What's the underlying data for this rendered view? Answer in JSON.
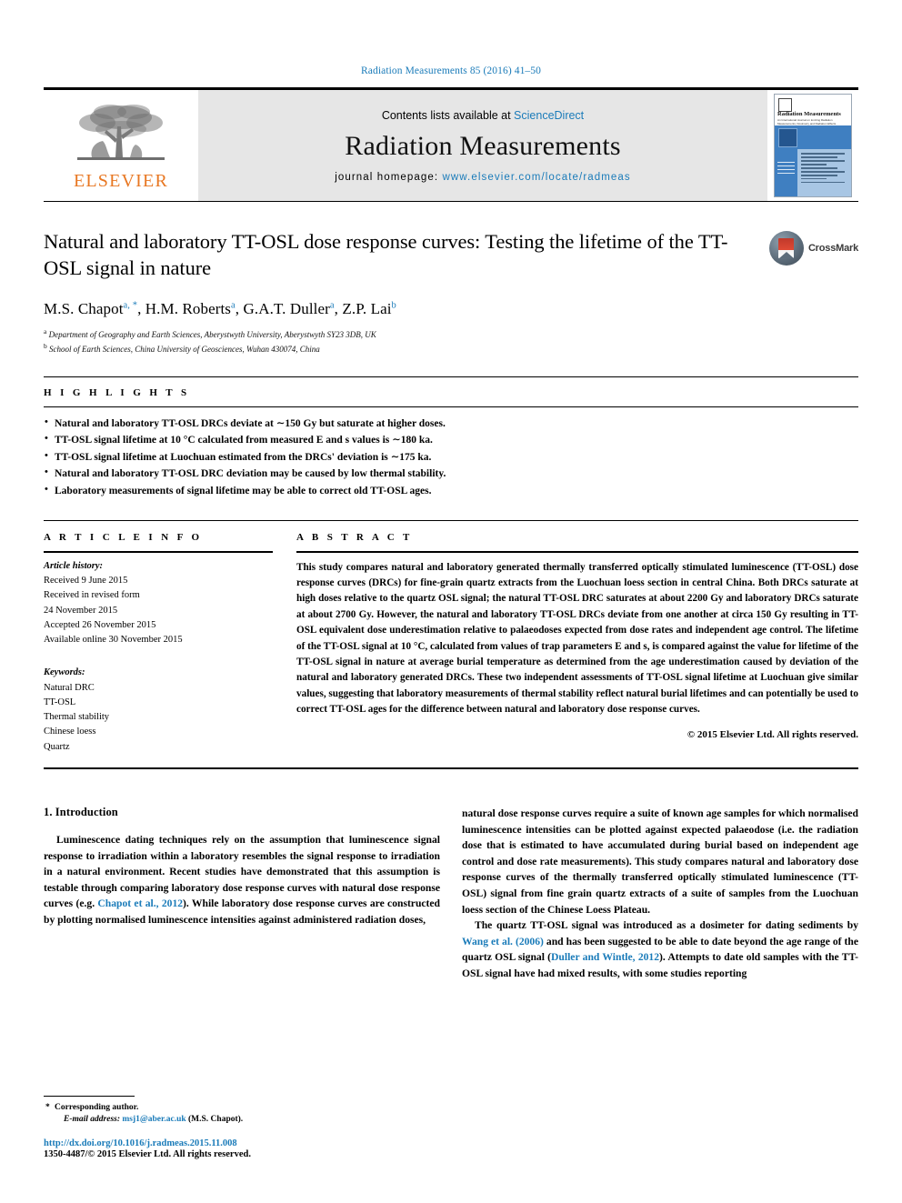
{
  "running_head": "Radiation Measurements 85 (2016) 41–50",
  "masthead": {
    "publisher_logo_text": "ELSEVIER",
    "contents_prefix": "Contents lists available at ",
    "contents_link": "ScienceDirect",
    "journal_name": "Radiation Measurements",
    "homepage_prefix": "journal homepage: ",
    "homepage_url": "www.elsevier.com/locate/radmeas",
    "cover": {
      "title": "Radiation Measurements",
      "subtitle": "An International Journal on Ionizing Radiation Measurements, Dosimetry and Radiation Effects"
    }
  },
  "article": {
    "title": "Natural and laboratory TT-OSL dose response curves: Testing the lifetime of the TT-OSL signal in nature",
    "authors": [
      {
        "name": "M.S. Chapot",
        "marks": "a, *"
      },
      {
        "name": "H.M. Roberts",
        "marks": "a"
      },
      {
        "name": "G.A.T. Duller",
        "marks": "a"
      },
      {
        "name": "Z.P. Lai",
        "marks": "b"
      }
    ],
    "affiliations": [
      {
        "mark": "a",
        "text": "Department of Geography and Earth Sciences, Aberystwyth University, Aberystwyth SY23 3DB, UK"
      },
      {
        "mark": "b",
        "text": "School of Earth Sciences, China University of Geosciences, Wuhan 430074, China"
      }
    ],
    "crossmark_label": "CrossMark"
  },
  "highlights": {
    "label": "H I G H L I G H T S",
    "items": [
      "Natural and laboratory TT-OSL DRCs deviate at ∼150 Gy but saturate at higher doses.",
      "TT-OSL signal lifetime at 10 °C calculated from measured E and s values is ∼180 ka.",
      "TT-OSL signal lifetime at Luochuan estimated from the DRCs' deviation is ∼175 ka.",
      "Natural and laboratory TT-OSL DRC deviation may be caused by low thermal stability.",
      "Laboratory measurements of signal lifetime may be able to correct old TT-OSL ages."
    ]
  },
  "article_info": {
    "label": "A R T I C L E  I N F O",
    "history_heading": "Article history:",
    "history": [
      "Received 9 June 2015",
      "Received in revised form",
      "24 November 2015",
      "Accepted 26 November 2015",
      "Available online 30 November 2015"
    ],
    "keywords_heading": "Keywords:",
    "keywords": [
      "Natural DRC",
      "TT-OSL",
      "Thermal stability",
      "Chinese loess",
      "Quartz"
    ]
  },
  "abstract": {
    "label": "A B S T R A C T",
    "text": "This study compares natural and laboratory generated thermally transferred optically stimulated luminescence (TT-OSL) dose response curves (DRCs) for fine-grain quartz extracts from the Luochuan loess section in central China. Both DRCs saturate at high doses relative to the quartz OSL signal; the natural TT-OSL DRC saturates at about 2200 Gy and laboratory DRCs saturate at about 2700 Gy. However, the natural and laboratory TT-OSL DRCs deviate from one another at circa 150 Gy resulting in TT-OSL equivalent dose underestimation relative to palaeodoses expected from dose rates and independent age control. The lifetime of the TT-OSL signal at 10 °C, calculated from values of trap parameters E and s, is compared against the value for lifetime of the TT-OSL signal in nature at average burial temperature as determined from the age underestimation caused by deviation of the natural and laboratory generated DRCs. These two independent assessments of TT-OSL signal lifetime at Luochuan give similar values, suggesting that laboratory measurements of thermal stability reflect natural burial lifetimes and can potentially be used to correct TT-OSL ages for the difference between natural and laboratory dose response curves.",
    "copyright": "© 2015 Elsevier Ltd. All rights reserved."
  },
  "body": {
    "section_number_title": "1. Introduction",
    "left_para_1_a": "Luminescence dating techniques rely on the assumption that luminescence signal response to irradiation within a laboratory resembles the signal response to irradiation in a natural environment. Recent studies have demonstrated that this assumption is testable through comparing laboratory dose response curves with natural dose response curves (e.g. ",
    "left_para_1_ref": "Chapot et al., 2012",
    "left_para_1_b": "). While laboratory dose response curves are constructed by plotting normalised luminescence intensities against administered radiation doses,",
    "right_para_1_cont": "natural dose response curves require a suite of known age samples for which normalised luminescence intensities can be plotted against expected palaeodose (i.e. the radiation dose that is estimated to have accumulated during burial based on independent age control and dose rate measurements). This study compares natural and laboratory dose response curves of the thermally transferred optically stimulated luminescence (TT-OSL) signal from fine grain quartz extracts of a suite of samples from the Luochuan loess section of the Chinese Loess Plateau.",
    "right_para_2_a": "The quartz TT-OSL signal was introduced as a dosimeter for dating sediments by ",
    "right_para_2_ref1": "Wang et al. (2006)",
    "right_para_2_b": " and has been suggested to be able to date beyond the age range of the quartz OSL signal (",
    "right_para_2_ref2": "Duller and Wintle, 2012",
    "right_para_2_c": "). Attempts to date old samples with the TT-OSL signal have had mixed results, with some studies reporting"
  },
  "footnote": {
    "corresponding": "Corresponding author.",
    "email_label": "E-mail address:",
    "email": "msj1@aber.ac.uk",
    "email_suffix": "(M.S. Chapot).",
    "doi": "http://dx.doi.org/10.1016/j.radmeas.2015.11.008",
    "issn_line": "1350-4487/© 2015 Elsevier Ltd. All rights reserved."
  },
  "colors": {
    "link_blue": "#1a7bb9",
    "elsevier_orange": "#E87722",
    "masthead_grey": "#e6e6e6"
  }
}
